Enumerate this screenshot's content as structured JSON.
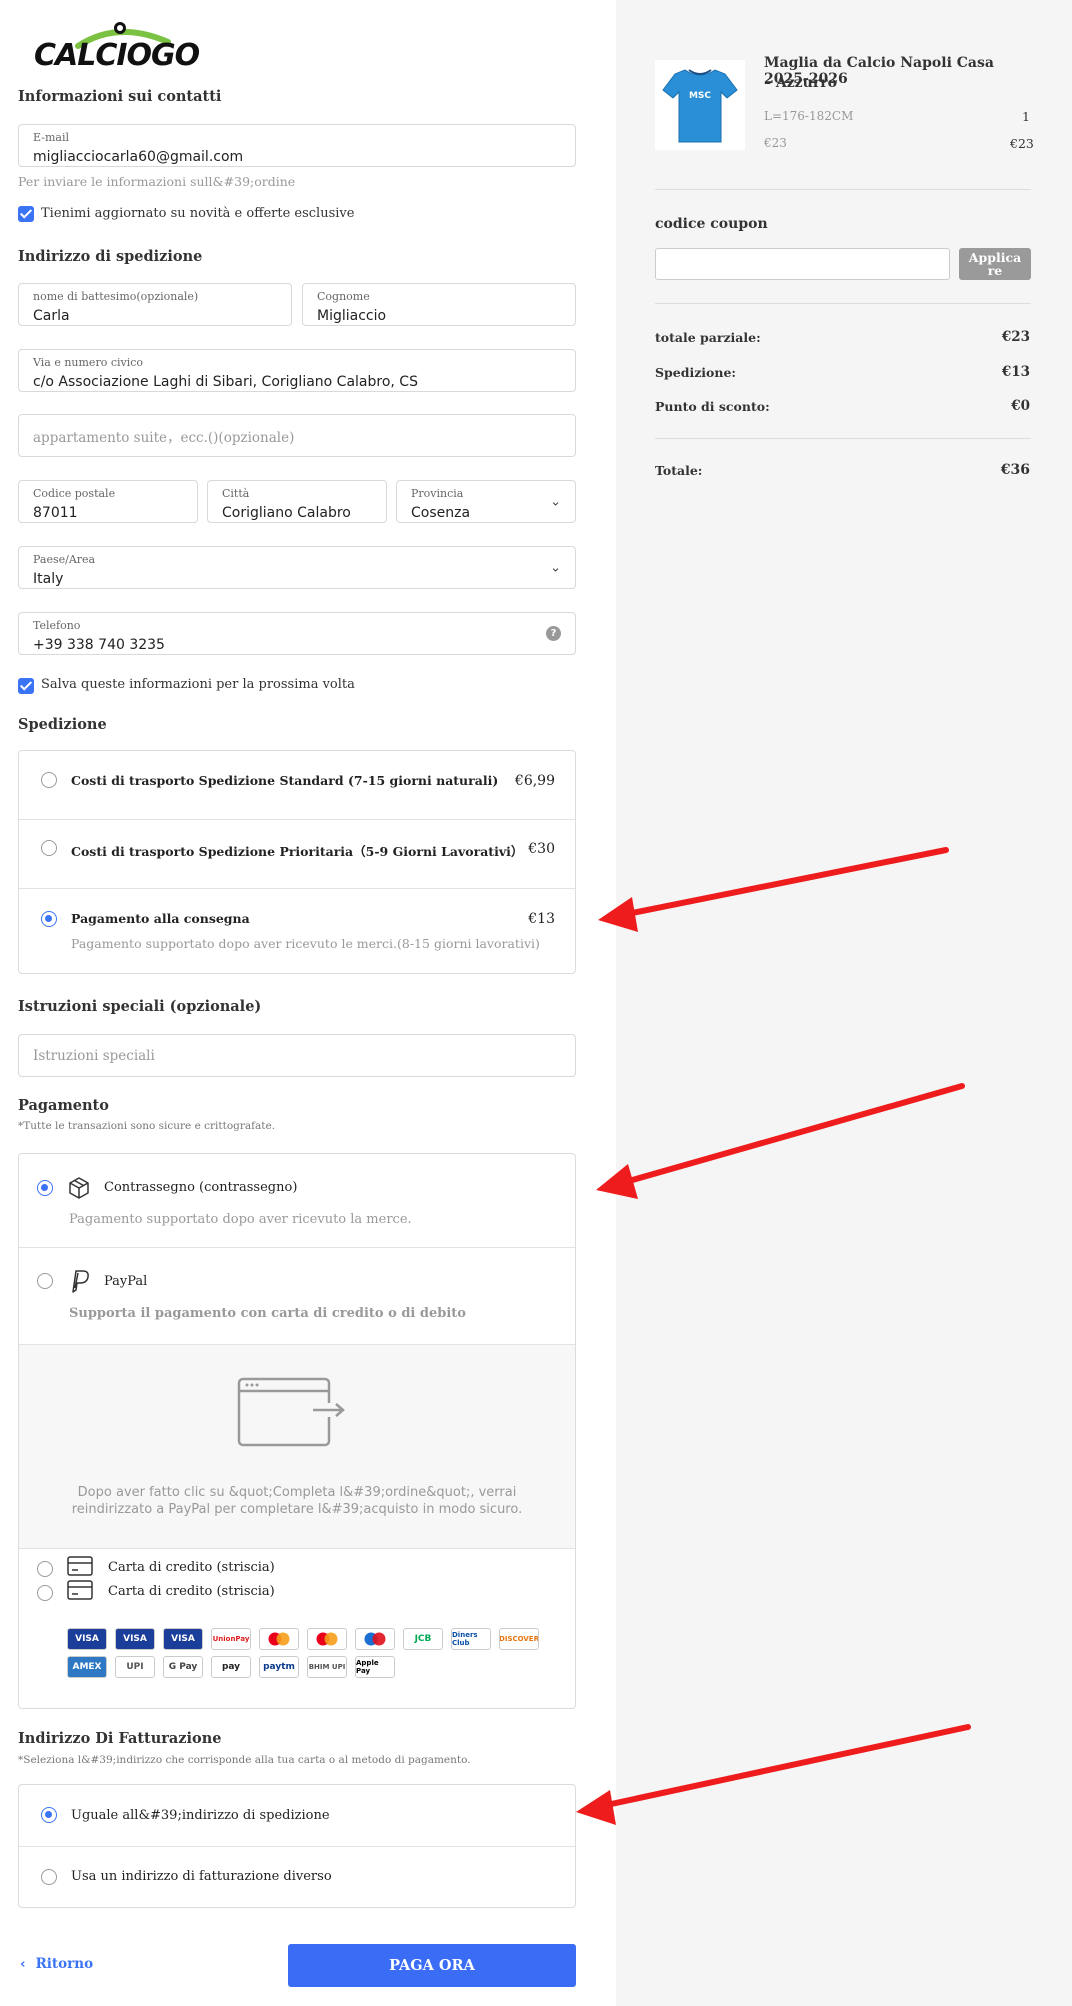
{
  "brand": {
    "logo_text": "CALCIOGO",
    "accent": "#3b73f5",
    "logo_green": "#7bc242"
  },
  "contact": {
    "title": "Informazioni sui contatti",
    "email_label": "E-mail",
    "email_value": "migliacciocarla60@gmail.com",
    "email_hint": "Per inviare le informazioni sull&#39;ordine",
    "newsletter_label": "Tienimi aggiornato su novità e offerte esclusive"
  },
  "shipping_address": {
    "title": "Indirizzo di spedizione",
    "first_name_label": "nome di battesimo(opzionale)",
    "first_name_value": "Carla",
    "last_name_label": "Cognome",
    "last_name_value": "Migliaccio",
    "street_label": "Via e numero civico",
    "street_value": "c/o Associazione Laghi di Sibari, Corigliano Calabro, CS",
    "apt_placeholder": "appartamento suite，ecc.()(opzionale)",
    "postal_label": "Codice postale",
    "postal_value": "87011",
    "city_label": "Città",
    "city_value": "Corigliano Calabro",
    "province_label": "Provincia",
    "province_value": "Cosenza",
    "country_label": "Paese/Area",
    "country_value": "Italy",
    "phone_label": "Telefono",
    "phone_value": "+39 338 740 3235",
    "save_label": "Salva queste informazioni per la prossima volta"
  },
  "shipping": {
    "title": "Spedizione",
    "options": [
      {
        "label": "Costi di trasporto Spedizione Standard (7-15 giorni naturali)",
        "price": "€6,99"
      },
      {
        "label": "Costi di trasporto Spedizione Prioritaria（5-9 Giorni Lavorativi）",
        "price": "€30"
      },
      {
        "label": "Pagamento alla consegna",
        "price": "€13",
        "desc": "Pagamento supportato dopo aver ricevuto le merci.(8-15 giorni lavorativi)"
      }
    ]
  },
  "instructions": {
    "title": "Istruzioni speciali (opzionale)",
    "placeholder": "Istruzioni speciali"
  },
  "payment": {
    "title": "Pagamento",
    "subtitle": "*Tutte le transazioni sono sicure e crittografate.",
    "cod_label": "Contrassegno (contrassegno)",
    "cod_desc": "Pagamento supportato dopo aver ricevuto la merce.",
    "paypal_label": "PayPal",
    "paypal_desc": "Supporta il pagamento con carta di credito o di debito",
    "paypal_redirect_1": "Dopo aver fatto clic su &quot;Completa l&#39;ordine&quot;, verrai",
    "paypal_redirect_2": "reindirizzato a PayPal per completare l&#39;acquisto in modo sicuro.",
    "card1_label": "Carta di credito (striscia)",
    "card2_label": "Carta di credito (striscia)",
    "card_logos_row1": [
      "VISA",
      "VISA",
      "VISA",
      "UnionPay",
      "mastercard",
      "mastercard",
      "maestro",
      "JCB",
      "Diners Club",
      "DISCOVER"
    ],
    "card_logos_row2": [
      "AMEX",
      "UPI",
      "G Pay",
      "pay",
      "paytm",
      "BHIM UPI",
      "Apple Pay"
    ]
  },
  "billing": {
    "title": "Indirizzo Di Fatturazione",
    "subtitle": "*Seleziona l&#39;indirizzo che corrisponde alla tua carta o al metodo di pagamento.",
    "same_label": "Uguale all&#39;indirizzo di spedizione",
    "different_label": "Usa un indirizzo di fatturazione diverso"
  },
  "footer": {
    "back_label": "Ritorno",
    "pay_label": "PAGA ORA"
  },
  "summary": {
    "product_name_1": "Maglia da Calcio Napoli Casa 2025-2026",
    "product_name_2": "– Azzurro",
    "variant": "L=176-182CM",
    "quantity": "1",
    "unit_price": "€23",
    "line_total": "€23",
    "coupon_title": "codice coupon",
    "coupon_btn_1": "Applica",
    "coupon_btn_2": "re",
    "subtotal_label": "totale parziale:",
    "subtotal_value": "€23",
    "shipping_label": "Spedizione:",
    "shipping_value": "€13",
    "discount_label": "Punto di sconto:",
    "discount_value": "€0",
    "total_label": "Totale:",
    "total_value": "€36",
    "jersey_sponsor": "MSC"
  }
}
